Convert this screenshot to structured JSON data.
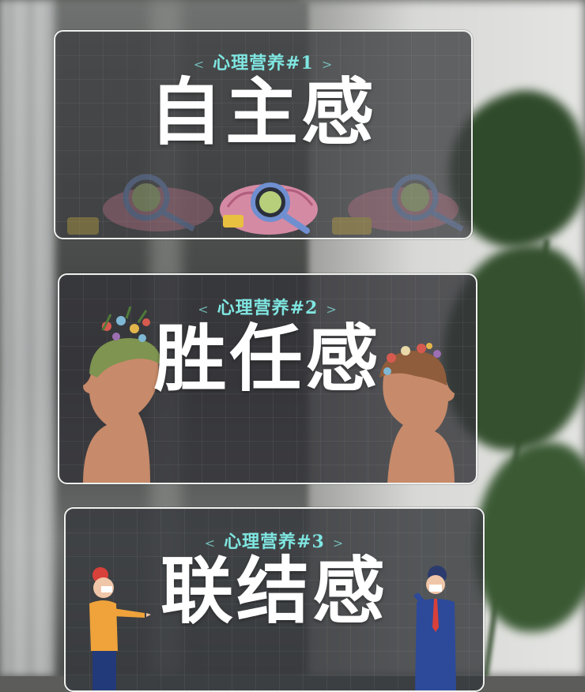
{
  "cards": [
    {
      "kicker": "心理营养#1",
      "title": "自主感"
    },
    {
      "kicker": "心理营养#2",
      "title": "胜任感"
    },
    {
      "kicker": "心理营养#3",
      "title": "联结感"
    }
  ],
  "chevrons": {
    "left": "<",
    "right": ">"
  },
  "colors": {
    "kicker": "#7fe6e1",
    "title": "#ffffff",
    "card_border": "#eef0ee"
  },
  "icons": [
    "brain-magnifier-icon",
    "chat-bubble-icon",
    "flower-head-left-icon",
    "flower-head-right-icon",
    "woman-pointing-icon",
    "man-in-suit-icon"
  ]
}
